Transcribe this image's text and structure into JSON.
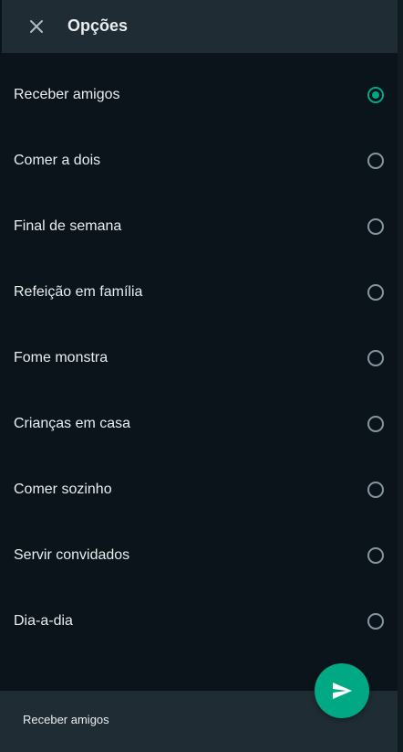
{
  "header": {
    "title": "Opções",
    "close_icon": "close-icon"
  },
  "options": [
    {
      "label": "Receber amigos",
      "selected": true
    },
    {
      "label": "Comer a dois",
      "selected": false
    },
    {
      "label": "Final de semana",
      "selected": false
    },
    {
      "label": "Refeição em família",
      "selected": false
    },
    {
      "label": "Fome monstra",
      "selected": false
    },
    {
      "label": "Crianças em casa",
      "selected": false
    },
    {
      "label": "Comer sozinho",
      "selected": false
    },
    {
      "label": "Servir convidados",
      "selected": false
    },
    {
      "label": "Dia-a-dia",
      "selected": false
    }
  ],
  "footer": {
    "selected_text": "Receber amigos",
    "send_icon": "send-icon"
  },
  "colors": {
    "background": "#0b141a",
    "header": "#1f2c34",
    "accent": "#00a884",
    "text": "#e9edef",
    "radio_border": "#8696a0"
  }
}
